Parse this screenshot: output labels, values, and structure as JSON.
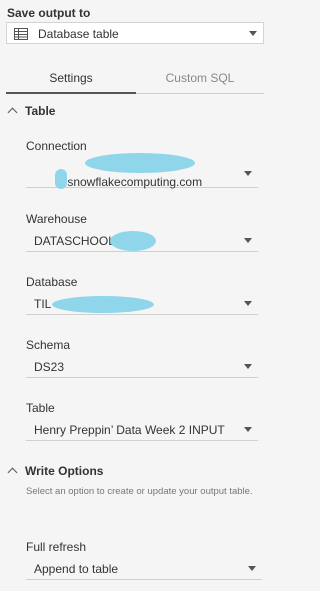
{
  "header": {
    "title": "Save output to",
    "output_type": "Database table",
    "output_type_icon": "table-icon"
  },
  "tabs": [
    {
      "label": "Settings",
      "active": true
    },
    {
      "label": "Custom SQL",
      "active": false
    }
  ],
  "table_section": {
    "title": "Table",
    "fields": {
      "connection": {
        "label": "Connection",
        "value": ".snowflakecomputing.com"
      },
      "warehouse": {
        "label": "Warehouse",
        "value": "DATASCHOOL"
      },
      "database": {
        "label": "Database",
        "value": "TIL"
      },
      "schema": {
        "label": "Schema",
        "value": "DS23"
      },
      "table": {
        "label": "Table",
        "value": "Henry Preppin’ Data Week 2 INPUT"
      }
    }
  },
  "write_options": {
    "title": "Write Options",
    "description": "Select an option to create or update your output table.",
    "mode_label": "Full refresh",
    "mode_value": "Append to table"
  },
  "colors": {
    "background": "#f5f5f5",
    "redaction": "#8fd6eb",
    "active_tab_underline": "#555555"
  }
}
